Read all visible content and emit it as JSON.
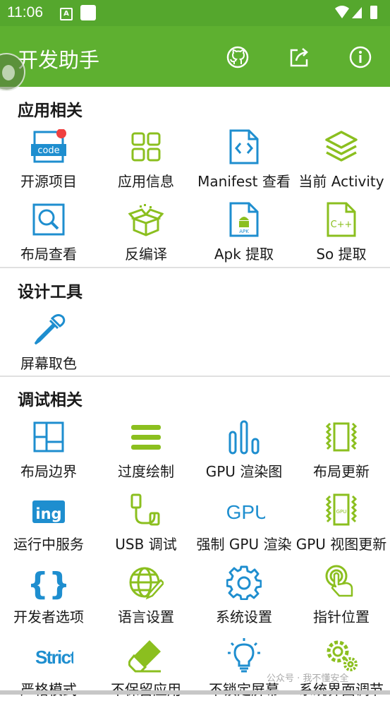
{
  "status": {
    "time": "11:06",
    "notif_a": "A"
  },
  "appbar": {
    "title": "开发助手"
  },
  "sections": [
    {
      "title": "应用相关",
      "items": [
        {
          "label": "开源项目",
          "icon": "code-icon",
          "badge": true
        },
        {
          "label": "应用信息",
          "icon": "grid-icon"
        },
        {
          "label": "Manifest 查看",
          "icon": "manifest-file-icon"
        },
        {
          "label": "当前 Activity",
          "icon": "layers-icon"
        },
        {
          "label": "布局查看",
          "icon": "layout-search-icon"
        },
        {
          "label": "反编译",
          "icon": "open-box-icon"
        },
        {
          "label": "Apk 提取",
          "icon": "apk-file-icon"
        },
        {
          "label": "So 提取",
          "icon": "cpp-file-icon"
        }
      ]
    },
    {
      "title": "设计工具",
      "items": [
        {
          "label": "屏幕取色",
          "icon": "eyedropper-icon"
        }
      ]
    },
    {
      "title": "调试相关",
      "items": [
        {
          "label": "布局边界",
          "icon": "layout-bounds-icon"
        },
        {
          "label": "过度绘制",
          "icon": "menu-lines-icon"
        },
        {
          "label": "GPU 渲染图",
          "icon": "bar-chart-icon"
        },
        {
          "label": "布局更新",
          "icon": "layout-update-icon"
        },
        {
          "label": "运行中服务",
          "icon": "ing-icon",
          "icon_text": "ing"
        },
        {
          "label": "USB 调试",
          "icon": "usb-icon"
        },
        {
          "label": "强制 GPU 渲染",
          "icon": "gpu-text-icon",
          "icon_text": "GPU"
        },
        {
          "label": "GPU 视图更新",
          "icon": "gpu-chip-icon",
          "icon_text": "GPU"
        },
        {
          "label": "开发者选项",
          "icon": "braces-icon"
        },
        {
          "label": "语言设置",
          "icon": "globe-pen-icon"
        },
        {
          "label": "系统设置",
          "icon": "gear-icon"
        },
        {
          "label": "指针位置",
          "icon": "touch-icon"
        },
        {
          "label": "严格模式",
          "icon": "strict-icon",
          "icon_text": "Strict"
        },
        {
          "label": "不保留应用",
          "icon": "eraser-icon"
        },
        {
          "label": "不锁定屏幕",
          "icon": "bulb-icon"
        },
        {
          "label": "系统界面调节",
          "icon": "gears-icon"
        }
      ]
    }
  ],
  "watermark": "公众号 · 我不懂安全"
}
